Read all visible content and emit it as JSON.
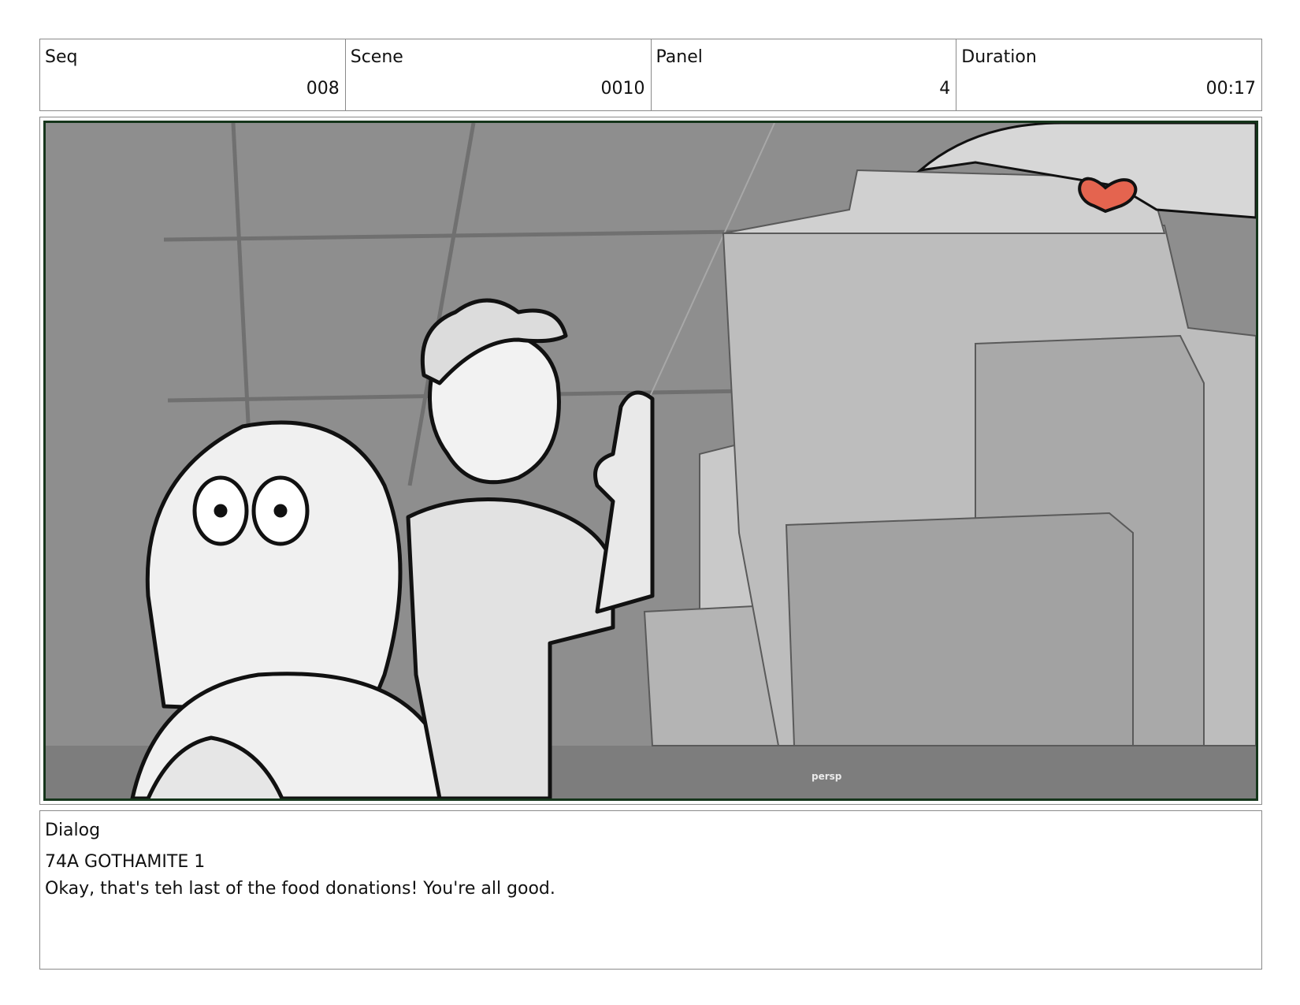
{
  "header": {
    "seq": {
      "label": "Seq",
      "value": "008"
    },
    "scene": {
      "label": "Scene",
      "value": "0010"
    },
    "panel": {
      "label": "Panel",
      "value": "4"
    },
    "duration": {
      "label": "Duration",
      "value": "00:17"
    }
  },
  "panel_image": {
    "viewport_label": "persp",
    "border_color": "#15351b",
    "heart_color": "#e4644f"
  },
  "dialog": {
    "label": "Dialog",
    "speaker": "74A GOTHAMITE 1",
    "line": "Okay, that's teh last of the food donations! You're all good."
  }
}
